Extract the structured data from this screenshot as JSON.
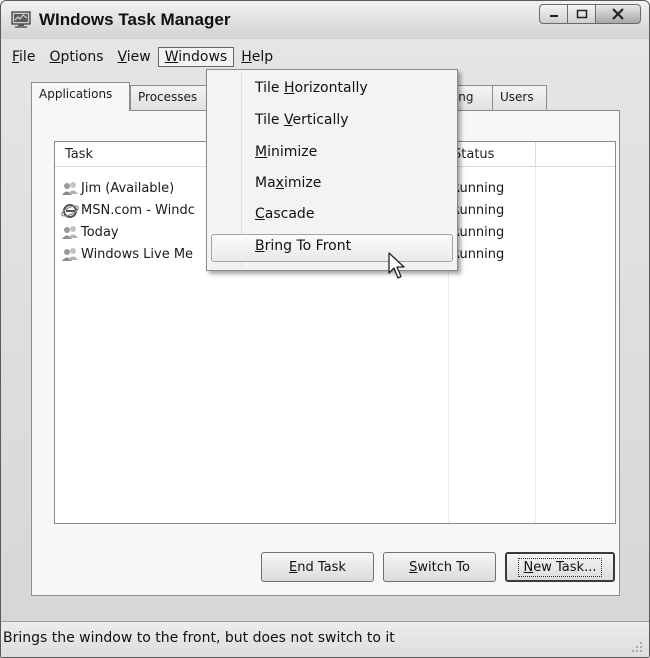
{
  "window": {
    "title": "WIndows Task Manager"
  },
  "menubar": {
    "items": [
      {
        "label_pre": "",
        "label_ul": "F",
        "label_post": "ile"
      },
      {
        "label_pre": "",
        "label_ul": "O",
        "label_post": "ptions"
      },
      {
        "label_pre": "",
        "label_ul": "V",
        "label_post": "iew"
      },
      {
        "label_pre": "",
        "label_ul": "W",
        "label_post": "indows"
      },
      {
        "label_pre": "",
        "label_ul": "H",
        "label_post": "elp"
      }
    ]
  },
  "tabs": {
    "applications": "Applications",
    "processes": "Processes",
    "networking_partial": "king",
    "users": "Users"
  },
  "list": {
    "columns": {
      "task": "Task",
      "status": "Status"
    },
    "rows": [
      {
        "icon": "messenger-buddy-icon",
        "name": "Jim (Available)",
        "status": "Running"
      },
      {
        "icon": "internet-explorer-icon",
        "name": "MSN.com - Windc",
        "status": "Running"
      },
      {
        "icon": "messenger-buddy-icon",
        "name": "Today",
        "status": "Running"
      },
      {
        "icon": "messenger-buddy-icon",
        "name": "Windows Live Me",
        "status": "Running"
      }
    ]
  },
  "buttons": {
    "end_task": {
      "ul": "E",
      "rest": "nd Task"
    },
    "switch_to": {
      "ul": "S",
      "rest": "witch To"
    },
    "new_task": {
      "ul": "N",
      "rest": "ew Task..."
    }
  },
  "dropdown": {
    "items": [
      {
        "pre": "Tile ",
        "ul": "H",
        "post": "orizontally"
      },
      {
        "pre": "Tile ",
        "ul": "V",
        "post": "ertically"
      },
      {
        "pre": "",
        "ul": "M",
        "post": "inimize"
      },
      {
        "pre": "Ma",
        "ul": "x",
        "post": "imize"
      },
      {
        "pre": "",
        "ul": "C",
        "post": "ascade"
      },
      {
        "pre": "",
        "ul": "B",
        "post": "ring To Front"
      }
    ]
  },
  "statusbar": {
    "text": "Brings the window to the front, but does not switch to it"
  },
  "colors": {
    "chrome": "#d6d6d6",
    "panel": "#f7f7f7",
    "text": "#1a1a1a"
  }
}
